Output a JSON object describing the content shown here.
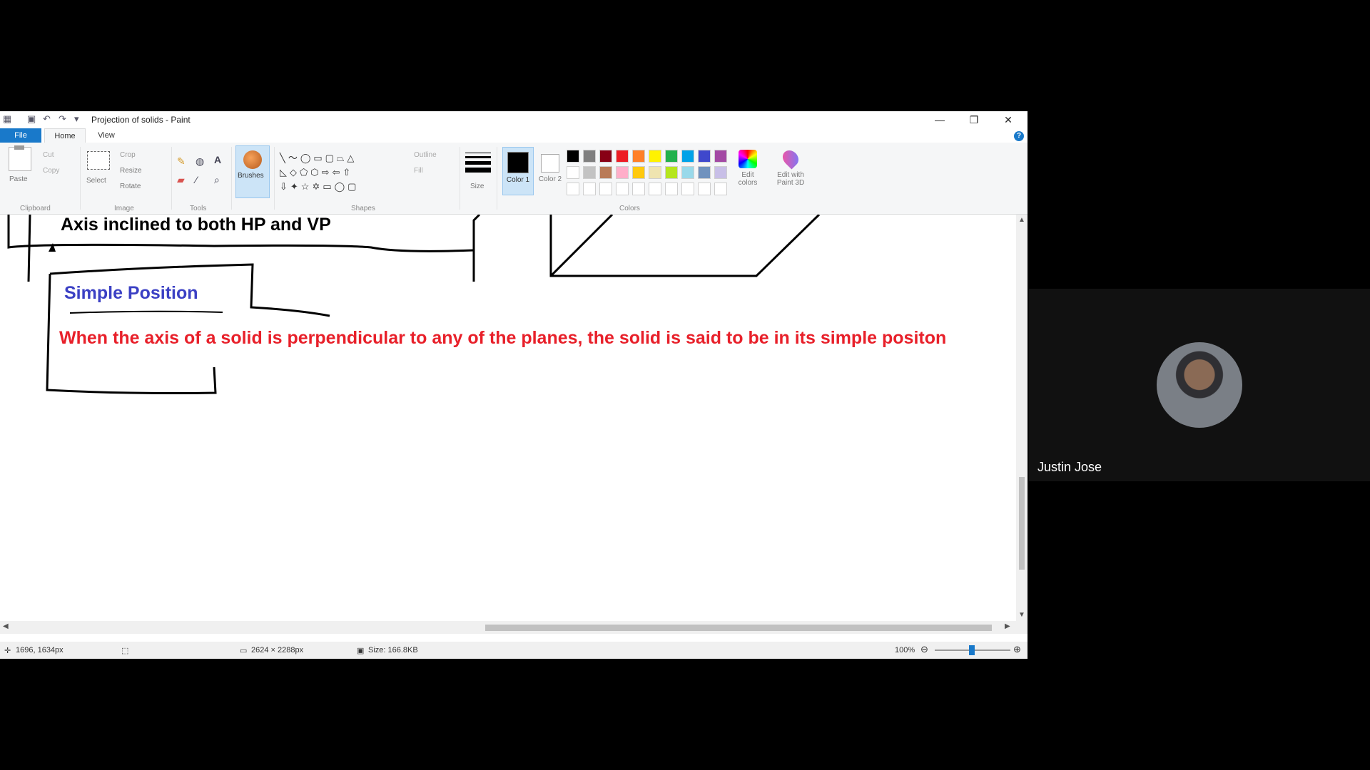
{
  "window": {
    "title": "Projection of solids - Paint",
    "controls": {
      "minimize": "—",
      "restore": "❐",
      "close": "✕"
    }
  },
  "menu": {
    "tabs": [
      "File",
      "Home",
      "View"
    ],
    "help": "?"
  },
  "ribbon": {
    "clipboard": {
      "paste": "Paste",
      "cut": "Cut",
      "copy": "Copy",
      "group": "Clipboard"
    },
    "image": {
      "select": "Select",
      "crop": "Crop",
      "resize": "Resize",
      "rotate": "Rotate",
      "group": "Image"
    },
    "tools": {
      "group": "Tools"
    },
    "brushes": {
      "label": "Brushes"
    },
    "shapes": {
      "outline": "Outline",
      "fill": "Fill",
      "group": "Shapes"
    },
    "size": {
      "label": "Size"
    },
    "colors": {
      "color1": "Color 1",
      "color2": "Color 2",
      "edit": "Edit colors",
      "paint3d": "Edit with Paint 3D",
      "group": "Colors",
      "palette_row1": [
        "#000000",
        "#7f7f7f",
        "#880015",
        "#ed1c24",
        "#ff7f27",
        "#fff200",
        "#22b14c",
        "#00a2e8",
        "#3f48cc",
        "#a349a4"
      ],
      "palette_row2": [
        "#ffffff",
        "#c3c3c3",
        "#b97a57",
        "#ffaec9",
        "#ffc90e",
        "#efe4b0",
        "#b5e61d",
        "#99d9ea",
        "#7092be",
        "#c8bfe7"
      ]
    }
  },
  "canvas": {
    "heading": "Axis inclined to both HP and VP",
    "subheading": "Simple Position",
    "definition": "When the axis of a solid is perpendicular to any of the planes, the solid is said to be in its simple positon"
  },
  "status": {
    "cursor": "1696, 1634px",
    "dimensions": "2624 × 2288px",
    "size": "Size: 166.8KB",
    "zoom": "100%"
  },
  "video": {
    "participant": "Justin Jose"
  }
}
